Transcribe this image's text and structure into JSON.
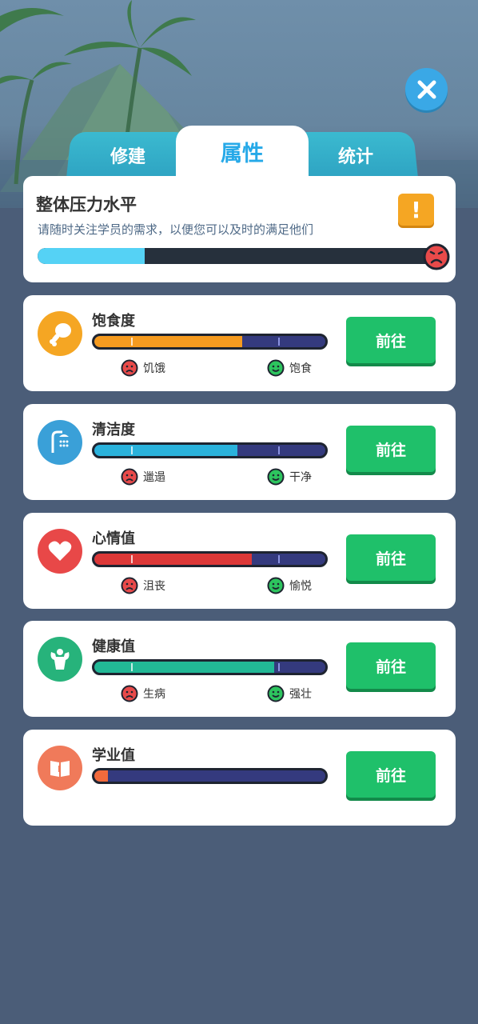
{
  "tabs": [
    {
      "label": "修建",
      "active": false
    },
    {
      "label": "属性",
      "active": true
    },
    {
      "label": "统计",
      "active": false
    }
  ],
  "pressure": {
    "title": "整体压力水平",
    "description": "请随时关注学员的需求，以便您可以及时的满足他们",
    "level": 0.27,
    "warning_icon": "exclamation-icon",
    "status_icon": "sad-face-icon"
  },
  "stats": [
    {
      "label": "饱食度",
      "icon": "chicken-leg-icon",
      "icon_color": "#f5a623",
      "fill_color": "#f59b20",
      "level": 0.64,
      "low_label": "饥饿",
      "high_label": "饱食",
      "button": "前往"
    },
    {
      "label": "清洁度",
      "icon": "shower-icon",
      "icon_color": "#3aa0d8",
      "fill_color": "#2ab2dc",
      "level": 0.62,
      "low_label": "邋遢",
      "high_label": "干净",
      "button": "前往"
    },
    {
      "label": "心情值",
      "icon": "heart-icon",
      "icon_color": "#e84848",
      "fill_color": "#dc3838",
      "level": 0.68,
      "low_label": "沮丧",
      "high_label": "愉悦",
      "button": "前往"
    },
    {
      "label": "健康值",
      "icon": "muscle-icon",
      "icon_color": "#27b37b",
      "fill_color": "#22b896",
      "level": 0.78,
      "low_label": "生病",
      "high_label": "强壮",
      "button": "前往"
    },
    {
      "label": "学业值",
      "icon": "book-icon",
      "icon_color": "#f07a5a",
      "fill_color": "#f26a3c",
      "level": 0.06,
      "low_label": "",
      "high_label": "",
      "button": "前往"
    }
  ]
}
